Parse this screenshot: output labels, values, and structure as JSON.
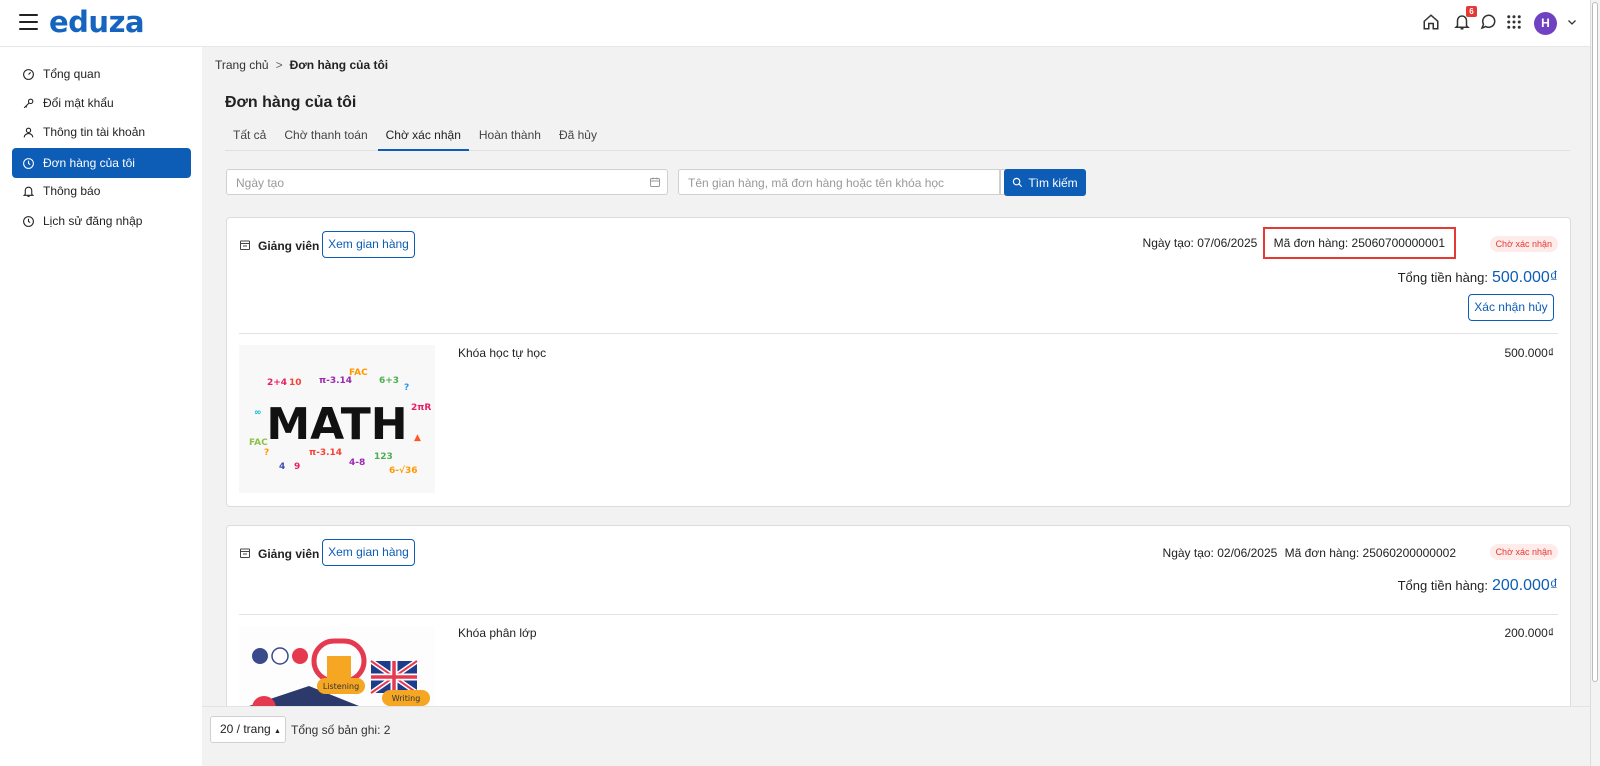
{
  "header": {
    "logo": "eduza",
    "notification_count": "6",
    "avatar_initial": "H"
  },
  "sidebar": {
    "items": [
      {
        "label": "Tổng quan",
        "icon": "dashboard-icon"
      },
      {
        "label": "Đổi mật khẩu",
        "icon": "key-icon"
      },
      {
        "label": "Thông tin tài khoản",
        "icon": "user-icon"
      },
      {
        "label": "Đơn hàng của tôi",
        "icon": "clock-icon",
        "active": true
      },
      {
        "label": "Thông báo",
        "icon": "bell-icon"
      },
      {
        "label": "Lịch sử đăng nhập",
        "icon": "history-icon"
      }
    ]
  },
  "breadcrumb": {
    "home": "Trang chủ",
    "separator": ">",
    "current": "Đơn hàng của tôi"
  },
  "page": {
    "title": "Đơn hàng của tôi"
  },
  "tabs": [
    {
      "label": "Tất cả"
    },
    {
      "label": "Chờ thanh toán"
    },
    {
      "label": "Chờ xác nhận",
      "active": true
    },
    {
      "label": "Hoàn thành"
    },
    {
      "label": "Đã hủy"
    }
  ],
  "filters": {
    "date_placeholder": "Ngày tạo",
    "search_placeholder": "Tên gian hàng, mã đơn hàng hoặc tên khóa học",
    "search_button": "Tìm kiếm"
  },
  "orders": [
    {
      "shop_name": "Giảng viên",
      "view_shop_label": "Xem gian hàng",
      "created_label": "Ngày tạo: 07/06/2025",
      "code_label": "Mã đơn hàng: 25060700000001",
      "status": "Chờ xác nhận",
      "total_label": "Tổng tiền hàng:",
      "total_amount": "500.000₫",
      "cancel_label": "Xác nhận hủy",
      "course_name": "Khóa học tự học",
      "course_price": "500.000₫",
      "thumb_text": "MATH"
    },
    {
      "shop_name": "Giảng viên",
      "view_shop_label": "Xem gian hàng",
      "created_label": "Ngày tạo: 02/06/2025",
      "code_label": "Mã đơn hàng: 25060200000002",
      "status": "Chờ xác nhận",
      "total_label": "Tổng tiền hàng:",
      "total_amount": "200.000₫",
      "course_name": "Khóa phân lớp",
      "course_price": "200.000₫",
      "thumb_labels": [
        "Listening",
        "Writing"
      ]
    }
  ],
  "footer": {
    "page_size": "20 / trang",
    "total_records": "Tổng số bản ghi: 2"
  },
  "colors": {
    "brand": "#0d5cb6",
    "status_red": "#e53935",
    "avatar": "#6f42c1"
  }
}
